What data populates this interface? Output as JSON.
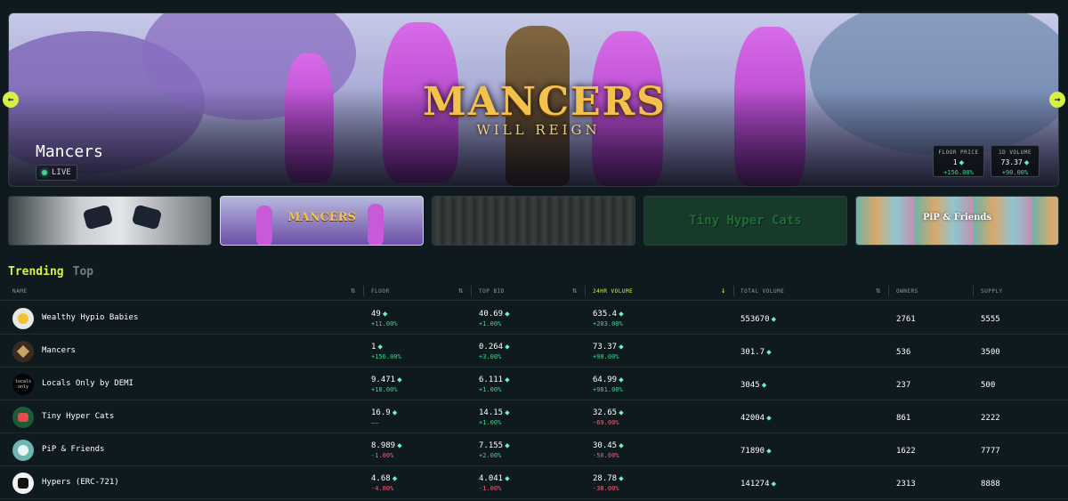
{
  "hero": {
    "logo_title": "MANCERS",
    "logo_subtitle": "WILL REIGN",
    "collection_name": "Mancers",
    "status": "LIVE",
    "floor_price": {
      "label": "FLOOR PRICE",
      "value": "1",
      "change": "+156.00%"
    },
    "volume_1d": {
      "label": "1D VOLUME",
      "value": "73.37",
      "change": "+90.00%"
    },
    "prev_arrow": "←",
    "next_arrow": "→"
  },
  "thumbnails": [
    {
      "label": ""
    },
    {
      "label": "MANCERS"
    },
    {
      "label": ""
    },
    {
      "label": "Tiny Hyper Cats"
    },
    {
      "label": "PiP & Friends"
    }
  ],
  "tabs": {
    "trending": "Trending",
    "top": "Top"
  },
  "table": {
    "headers": {
      "name": "NAME",
      "floor": "FLOOR",
      "top_bid": "TOP BID",
      "volume_24h": "24HR VOLUME",
      "total_volume": "TOTAL VOLUME",
      "owners": "OWNERS",
      "supply": "SUPPLY"
    },
    "sort_icon": "⇅",
    "sorted_icon": "↓",
    "eth_symbol": "⬥",
    "rows": [
      {
        "name": "Wealthy Hypio Babies",
        "floor": "49",
        "floor_change": "+11.00%",
        "top_bid": "40.69",
        "top_bid_change": "+1.00%",
        "vol24": "635.4",
        "vol24_change": "+203.00%",
        "total_volume": "553670",
        "owners": "2761",
        "supply": "5555"
      },
      {
        "name": "Mancers",
        "floor": "1",
        "floor_change": "+156.00%",
        "top_bid": "0.264",
        "top_bid_change": "+3.00%",
        "vol24": "73.37",
        "vol24_change": "+90.00%",
        "total_volume": "301.7",
        "owners": "536",
        "supply": "3500"
      },
      {
        "name": "Locals Only by DEMI",
        "floor": "9.471",
        "floor_change": "+18.00%",
        "top_bid": "6.111",
        "top_bid_change": "+1.00%",
        "vol24": "64.99",
        "vol24_change": "+981.00%",
        "total_volume": "3045",
        "owners": "237",
        "supply": "500"
      },
      {
        "name": "Tiny Hyper Cats",
        "floor": "16.9",
        "floor_change": "——",
        "top_bid": "14.15",
        "top_bid_change": "+1.00%",
        "vol24": "32.65",
        "vol24_change": "-69.00%",
        "total_volume": "42004",
        "owners": "861",
        "supply": "2222"
      },
      {
        "name": "PiP & Friends",
        "floor": "8.989",
        "floor_change": "-1.00%",
        "top_bid": "7.155",
        "top_bid_change": "+2.00%",
        "vol24": "30.45",
        "vol24_change": "-50.00%",
        "total_volume": "71890",
        "owners": "1622",
        "supply": "7777"
      },
      {
        "name": "Hypers (ERC-721)",
        "floor": "4.68",
        "floor_change": "-4.00%",
        "top_bid": "4.041",
        "top_bid_change": "-1.00%",
        "vol24": "28.78",
        "vol24_change": "-38.00%",
        "total_volume": "141274",
        "owners": "2313",
        "supply": "8888"
      }
    ],
    "avatar_texts": [
      "",
      "",
      "locals only",
      "",
      "",
      ""
    ]
  },
  "colors": {
    "accent": "#d6f046",
    "positive": "#3dd68c",
    "negative": "#ff5c7a",
    "background": "#0e1a1d"
  }
}
